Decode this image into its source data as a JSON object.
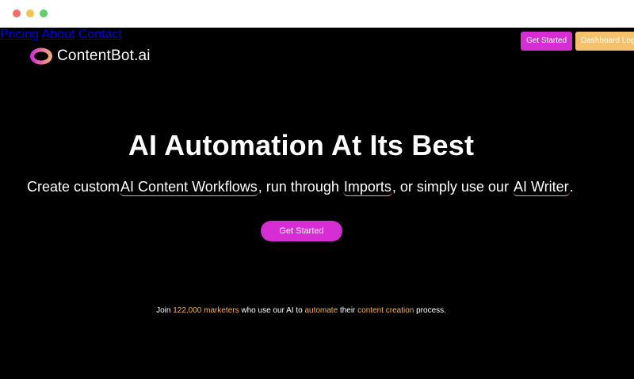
{
  "window": {
    "title": ""
  },
  "brand": {
    "name": "ContentBot.ai",
    "colors": {
      "pink": "#d62ed4",
      "orange": "#f6c16c",
      "accent_text": "#f2b25c"
    }
  },
  "nav": {
    "items": [
      {
        "label": "Pricing"
      },
      {
        "label": "About"
      },
      {
        "label": "Contact"
      }
    ]
  },
  "header_actions": {
    "get_started": "Get Started",
    "dashboard_login": "Dashboard Login"
  },
  "hero": {
    "headline": "AI Automation At Its Best",
    "sub_1": "Create custom",
    "sub_link_1": "AI Content Workflows",
    "sub_2": ", run through",
    "sub_link_2": "Imports",
    "sub_3": ", or simply use our",
    "sub_link_3": "AI Writer",
    "sub_4": ".",
    "cta": "Get Started"
  },
  "social_proof": {
    "join": "Join",
    "count": "122,000 marketers",
    "mid_1": "who use our AI to",
    "automate": "automate",
    "their": "their",
    "content_creation": "content creation",
    "end": "process."
  },
  "icons": {
    "logo": "ring-logo-icon",
    "window_close": "close-dot-icon",
    "window_min": "minimize-dot-icon",
    "window_max": "maximize-dot-icon"
  }
}
